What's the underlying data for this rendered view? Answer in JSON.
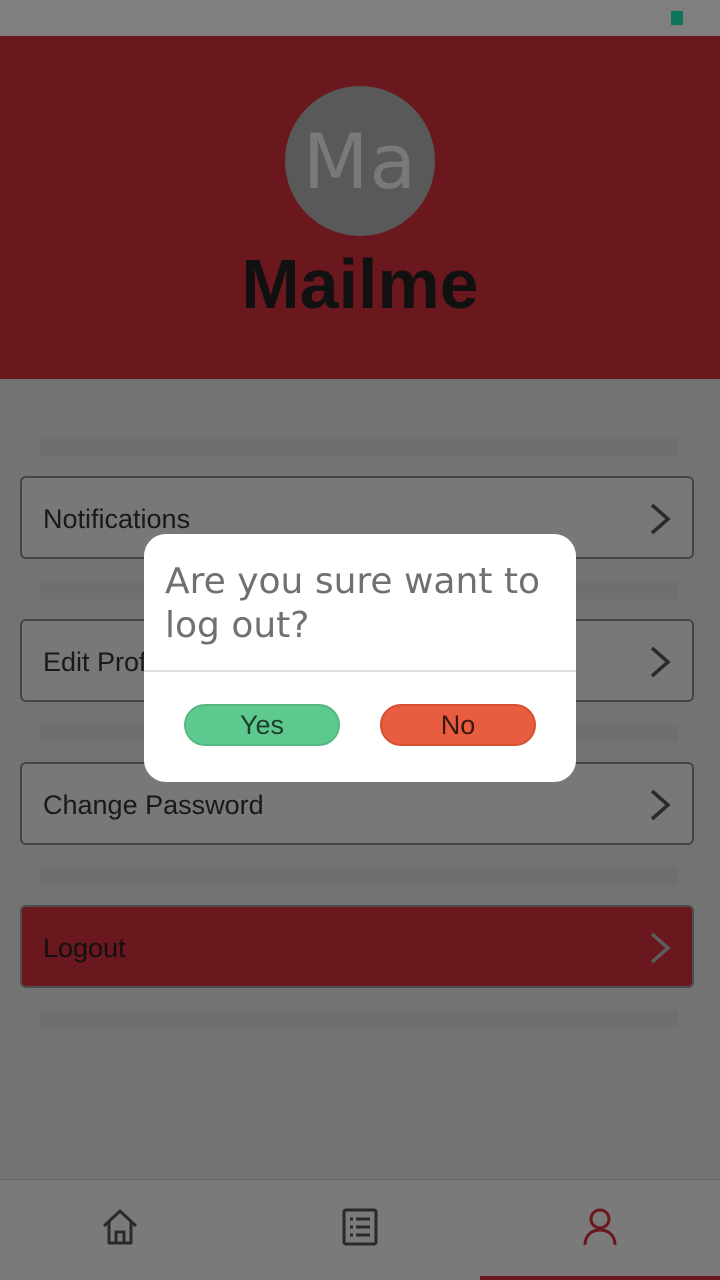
{
  "profile": {
    "avatar_initials": "Ma",
    "username": "Mailme"
  },
  "menu": {
    "items": [
      {
        "label": "Notifications"
      },
      {
        "label": "Edit Profile"
      },
      {
        "label": "Change Password"
      },
      {
        "label": "Logout"
      }
    ]
  },
  "dialog": {
    "message": "Are you sure want to log out?",
    "yes_label": "Yes",
    "no_label": "No"
  },
  "bottom_nav": {
    "items": [
      {
        "icon": "home-icon",
        "active": false
      },
      {
        "icon": "list-icon",
        "active": false
      },
      {
        "icon": "profile-icon",
        "active": true
      }
    ]
  },
  "colors": {
    "brand_red": "#d42f3c",
    "yes_green": "#5ec98e",
    "no_orange": "#e85c3f",
    "status_indicator": "#1de9b6"
  }
}
